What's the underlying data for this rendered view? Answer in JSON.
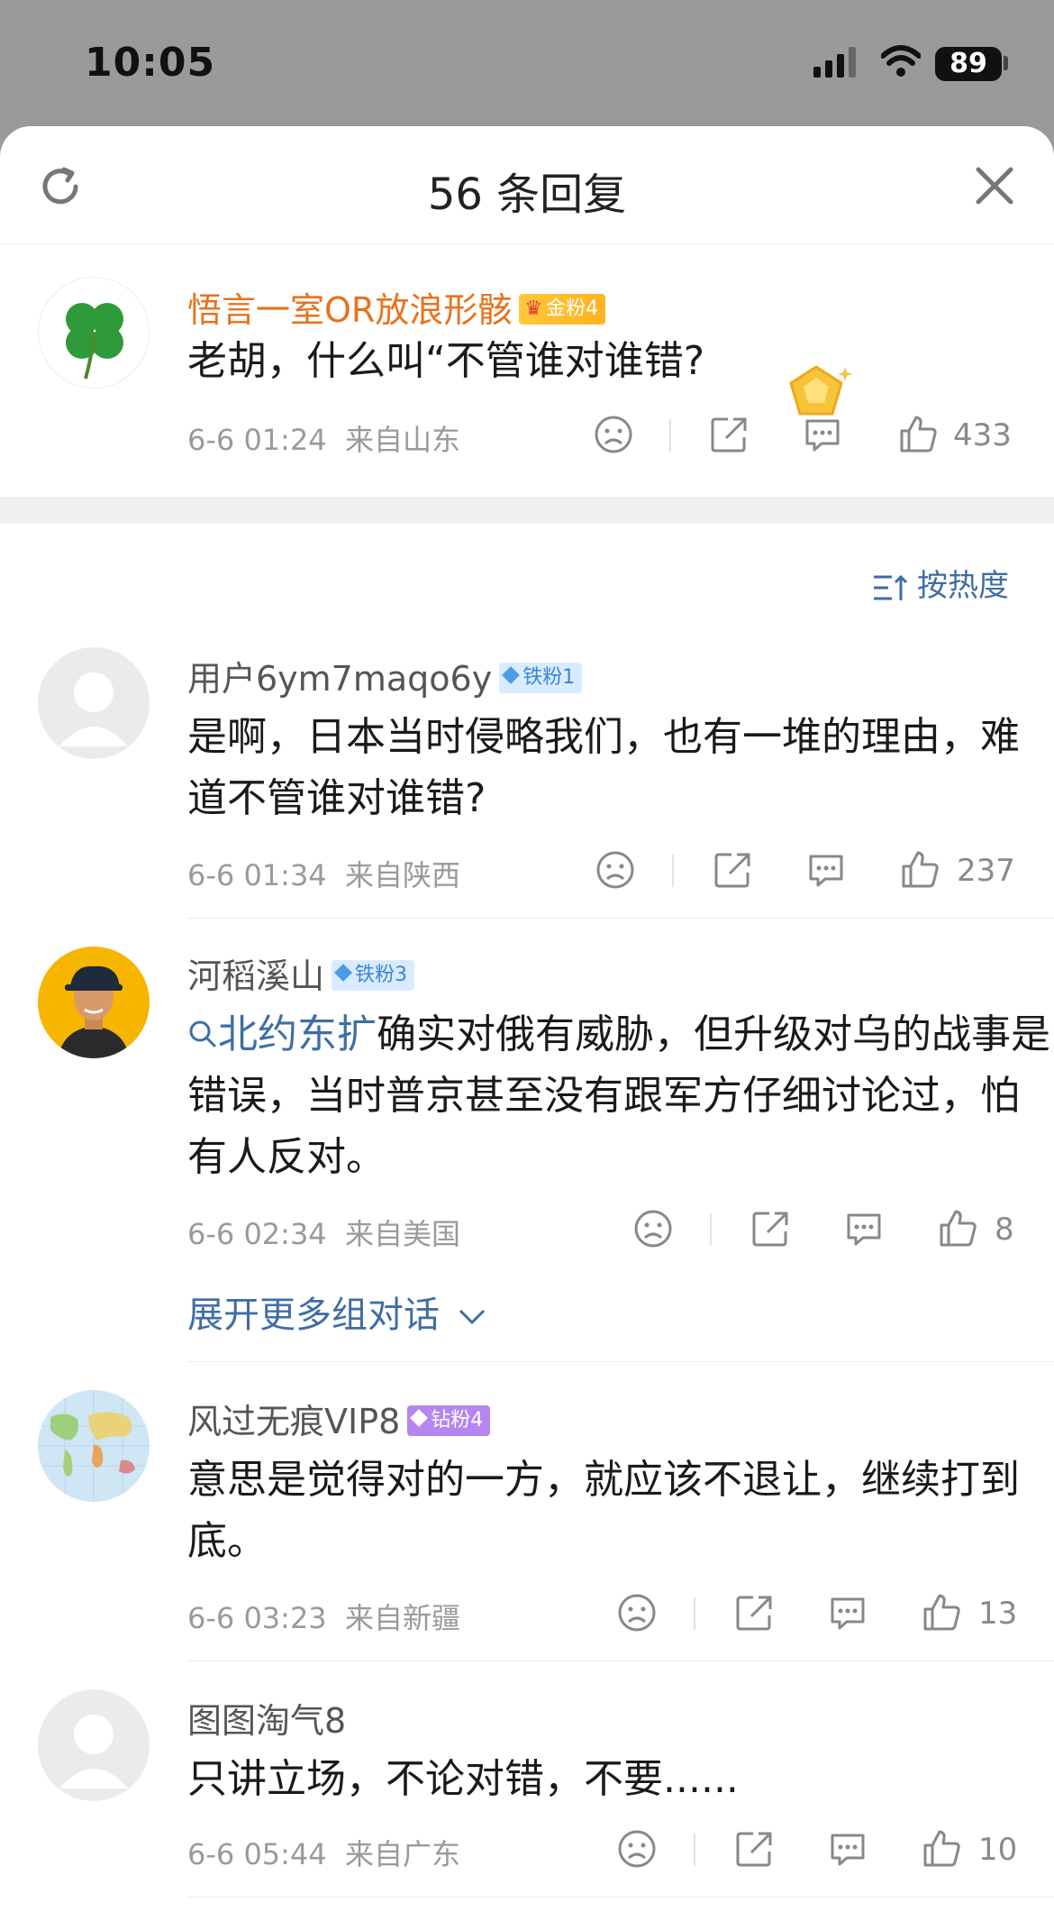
{
  "status_bar": {
    "time": "10:05",
    "battery": "89"
  },
  "header": {
    "title": "56 条回复"
  },
  "main_comment": {
    "username": "悟言一室OR放浪形骸",
    "badge": "金粉4",
    "text": "老胡，什么叫“不管谁对谁错?",
    "date": "6-6 01:24",
    "location": "来自山东",
    "likes": "433"
  },
  "sort": {
    "label": "按热度"
  },
  "replies": [
    {
      "username": "用户6ym7maqo6y",
      "badge": "铁粉1",
      "text": "是啊，日本当时侵略我们，也有一堆的理由，难道不管谁对谁错?",
      "date": "6-6 01:34",
      "location": "来自陕西",
      "likes": "237"
    },
    {
      "username": "河稻溪山",
      "badge": "铁粉3",
      "topic": "北约东扩",
      "text": "确实对俄有威胁，但升级对乌的战事是错误，当时普京甚至没有跟军方仔细讨论过，怕有人反对。",
      "date": "6-6 02:34",
      "location": "来自美国",
      "likes": "8",
      "expand_label": "展开更多组对话"
    },
    {
      "username": "风过无痕VIP8",
      "badge": "钻粉4",
      "text": "意思是觉得对的一方，就应该不退让，继续打到底。",
      "date": "6-6 03:23",
      "location": "来自新疆",
      "likes": "13"
    },
    {
      "username": "图图淘气8",
      "text": "只讲立场，不论对错，不要......",
      "date": "6-6 05:44",
      "location": "来自广东",
      "likes": "10"
    }
  ],
  "colors": {
    "accent_blue": "#3f6ea3",
    "name_orange": "#e8721c",
    "meta_gray": "#9a9a9a"
  }
}
